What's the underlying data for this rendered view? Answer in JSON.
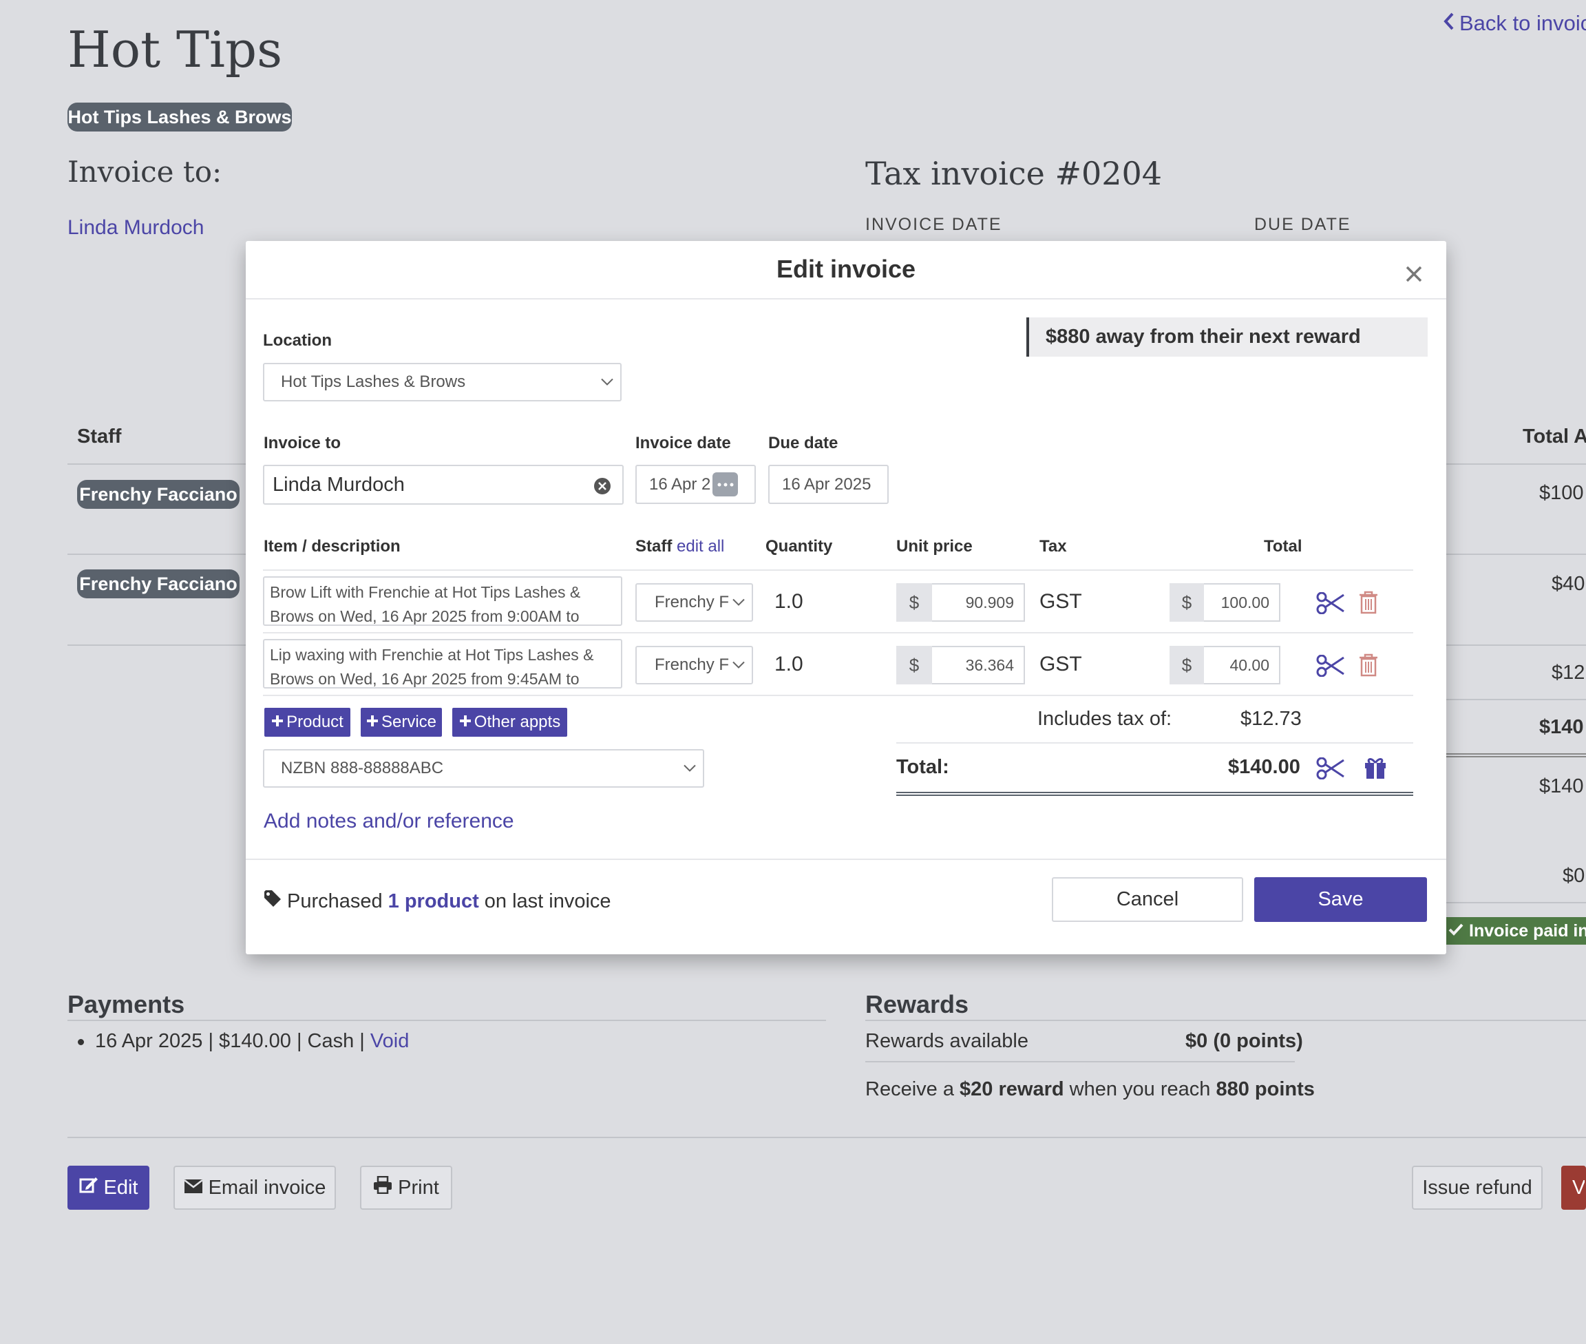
{
  "page": {
    "title": "Hot Tips",
    "back_link": "Back to invoic",
    "location_pill": "Hot Tips Lashes & Brows",
    "invoice_to_heading": "Invoice to:",
    "tax_invoice_heading": "Tax invoice #0204",
    "client_name": "Linda Murdoch",
    "invoice_date_label": "INVOICE DATE",
    "due_date_label": "DUE DATE",
    "staff_header": "Staff",
    "total_header": "Total A",
    "staff_rows": [
      {
        "name": "Frenchy Facciano",
        "amount": "$100"
      },
      {
        "name": "Frenchy Facciano",
        "amount": "$40"
      }
    ],
    "right_amounts": [
      "$12",
      "$140",
      "$140",
      "$0"
    ],
    "paid_badge": "Invoice paid in",
    "payments_heading": "Payments",
    "payment_line": "16 Apr 2025 | $140.00 | Cash |",
    "void_link": "Void",
    "rewards_heading": "Rewards",
    "rewards_available_label": "Rewards available",
    "rewards_available_value": "$0 (0 points)",
    "receive_pre": "Receive a",
    "receive_reward": "$20 reward",
    "receive_mid": "when you reach",
    "receive_points": "880 points",
    "buttons": {
      "edit": "Edit",
      "email": "Email invoice",
      "print": "Print",
      "refund": "Issue refund",
      "void_red": "V"
    }
  },
  "modal": {
    "title": "Edit invoice",
    "reward_notice": "$880 away from their next reward",
    "location_label": "Location",
    "location_value": "Hot Tips Lashes & Brows",
    "invoice_to_label": "Invoice to",
    "invoice_to_value": "Linda Murdoch",
    "invoice_date_label": "Invoice date",
    "invoice_date_value": "16 Apr 2",
    "due_date_label": "Due date",
    "due_date_value": "16 Apr 2025",
    "columns": {
      "item": "Item / description",
      "staff": "Staff",
      "edit_all": "edit all",
      "quantity": "Quantity",
      "unit_price": "Unit price",
      "tax": "Tax",
      "total": "Total"
    },
    "currency_symbol": "$",
    "items": [
      {
        "description": "Brow Lift with Frenchie at Hot Tips Lashes & Brows on Wed, 16 Apr 2025 from 9:00AM to",
        "staff": "Frenchy F",
        "quantity": "1.0",
        "unit_price": "90.909",
        "tax": "GST",
        "total": "100.00"
      },
      {
        "description": "Lip waxing with Frenchie at Hot Tips Lashes & Brows on Wed, 16 Apr 2025 from 9:45AM to",
        "staff": "Frenchy F",
        "quantity": "1.0",
        "unit_price": "36.364",
        "tax": "GST",
        "total": "40.00"
      }
    ],
    "add_buttons": {
      "product": "Product",
      "service": "Service",
      "other": "Other appts"
    },
    "nzbn_value": "NZBN 888-88888ABC",
    "includes_tax_label": "Includes tax of:",
    "includes_tax_value": "$12.73",
    "total_label": "Total:",
    "total_value": "$140.00",
    "add_notes_link": "Add notes and/or reference",
    "purchased_pre": "Purchased",
    "purchased_link": "1 product",
    "purchased_post": "on last invoice",
    "cancel": "Cancel",
    "save": "Save"
  },
  "colors": {
    "accent": "#4b45a6",
    "pill": "#5a626c",
    "paid_green": "#4f7a45",
    "danger_red": "#9b3b33"
  }
}
